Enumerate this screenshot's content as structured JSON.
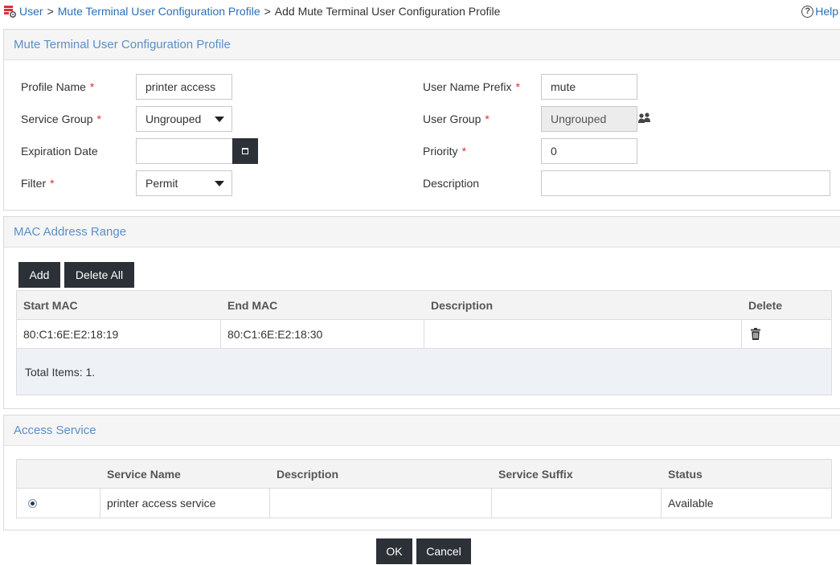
{
  "breadcrumb": {
    "items": [
      "User",
      "Mute Terminal User Configuration Profile"
    ],
    "current": "Add Mute Terminal User Configuration Profile",
    "separator": ">"
  },
  "help": {
    "label": "Help",
    "icon": "?"
  },
  "profile_panel": {
    "title": "Mute Terminal User Configuration Profile",
    "fields": {
      "profile_name": {
        "label": "Profile Name",
        "required": "*",
        "value": "printer access"
      },
      "service_group": {
        "label": "Service Group",
        "required": "*",
        "value": "Ungrouped"
      },
      "expiration_date": {
        "label": "Expiration Date",
        "value": ""
      },
      "filter": {
        "label": "Filter",
        "required": "*",
        "value": "Permit"
      },
      "user_name_prefix": {
        "label": "User Name Prefix",
        "required": "*",
        "value": "mute"
      },
      "user_group": {
        "label": "User Group",
        "required": "*",
        "value": "Ungrouped"
      },
      "priority": {
        "label": "Priority",
        "required": "*",
        "value": "0"
      },
      "description": {
        "label": "Description",
        "value": ""
      }
    }
  },
  "mac_panel": {
    "title": "MAC Address Range",
    "add_label": "Add",
    "delete_all_label": "Delete All",
    "columns": [
      "Start MAC",
      "End MAC",
      "Description",
      "Delete"
    ],
    "rows": [
      {
        "start_mac": "80:C1:6E:E2:18:19",
        "end_mac": "80:C1:6E:E2:18:30",
        "description": ""
      }
    ],
    "total": "Total Items: 1."
  },
  "access_panel": {
    "title": "Access Service",
    "columns": [
      "",
      "Service Name",
      "Description",
      "Service Suffix",
      "Status"
    ],
    "rows": [
      {
        "service_name": "printer access service",
        "description": "",
        "service_suffix": "",
        "status": "Available"
      }
    ]
  },
  "footer": {
    "ok_label": "OK",
    "cancel_label": "Cancel"
  },
  "colors": {
    "accent": "#5b8fc9",
    "link": "#2a6fb8",
    "button": "#2c3137",
    "required": "#d9322f"
  }
}
